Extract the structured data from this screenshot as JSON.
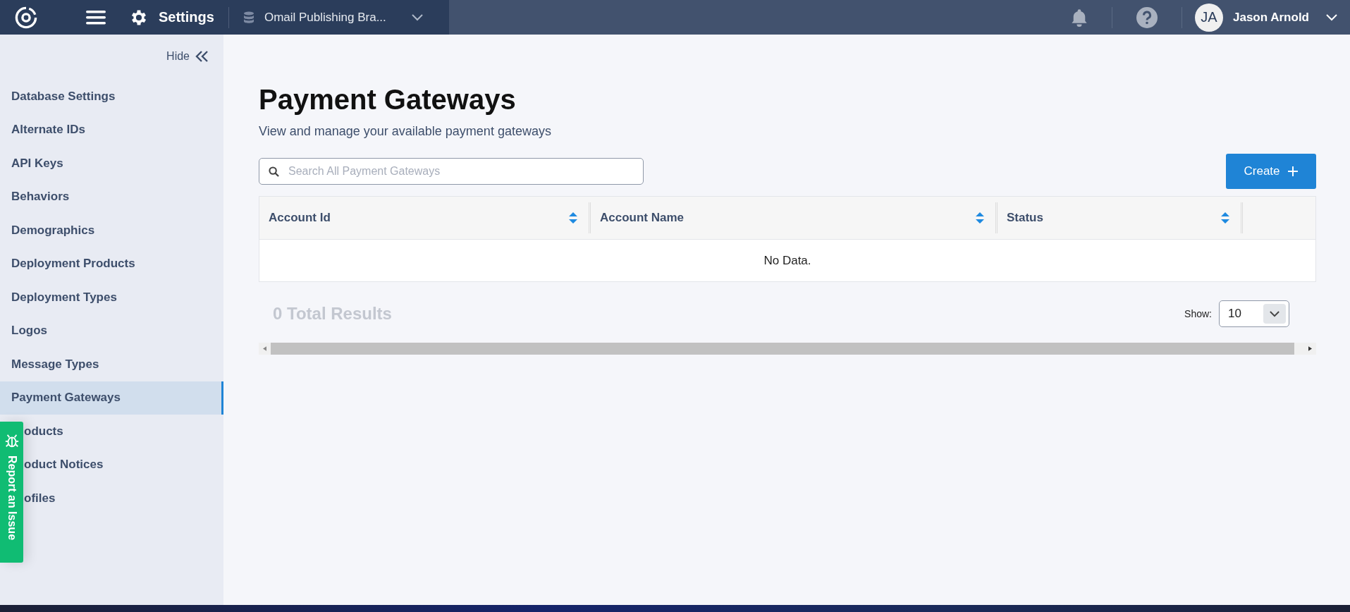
{
  "topbar": {
    "section": "Settings",
    "database": "Omail Publishing Bra...",
    "user": {
      "initials": "JA",
      "name": "Jason Arnold"
    }
  },
  "sidebar": {
    "hide_label": "Hide",
    "items": [
      {
        "label": "Database Settings",
        "selected": false,
        "partly_hidden": false
      },
      {
        "label": "Alternate IDs",
        "selected": false,
        "partly_hidden": false
      },
      {
        "label": "API Keys",
        "selected": false,
        "partly_hidden": false
      },
      {
        "label": "Behaviors",
        "selected": false,
        "partly_hidden": false
      },
      {
        "label": "Demographics",
        "selected": false,
        "partly_hidden": false
      },
      {
        "label": "Deployment Products",
        "selected": false,
        "partly_hidden": false
      },
      {
        "label": "Deployment Types",
        "selected": false,
        "partly_hidden": false
      },
      {
        "label": "Logos",
        "selected": false,
        "partly_hidden": false
      },
      {
        "label": "Message Types",
        "selected": false,
        "partly_hidden": false
      },
      {
        "label": "Payment Gateways",
        "selected": true,
        "partly_hidden": false
      },
      {
        "label": "oducts",
        "selected": false,
        "partly_hidden": true
      },
      {
        "label": "oduct Notices",
        "selected": false,
        "partly_hidden": true
      },
      {
        "label": "ofiles",
        "selected": false,
        "partly_hidden": true
      }
    ]
  },
  "report_tab": {
    "label": "Report an Issue"
  },
  "page": {
    "title": "Payment Gateways",
    "subtitle": "View and manage your available payment gateways"
  },
  "search": {
    "placeholder": "Search All Payment Gateways"
  },
  "create_button": {
    "label": "Create"
  },
  "table": {
    "columns": [
      {
        "label": "Account Id"
      },
      {
        "label": "Account Name"
      },
      {
        "label": "Status"
      }
    ],
    "empty_message": "No Data."
  },
  "footer": {
    "total": "0 Total Results",
    "show_label": "Show:",
    "page_size": "10"
  }
}
